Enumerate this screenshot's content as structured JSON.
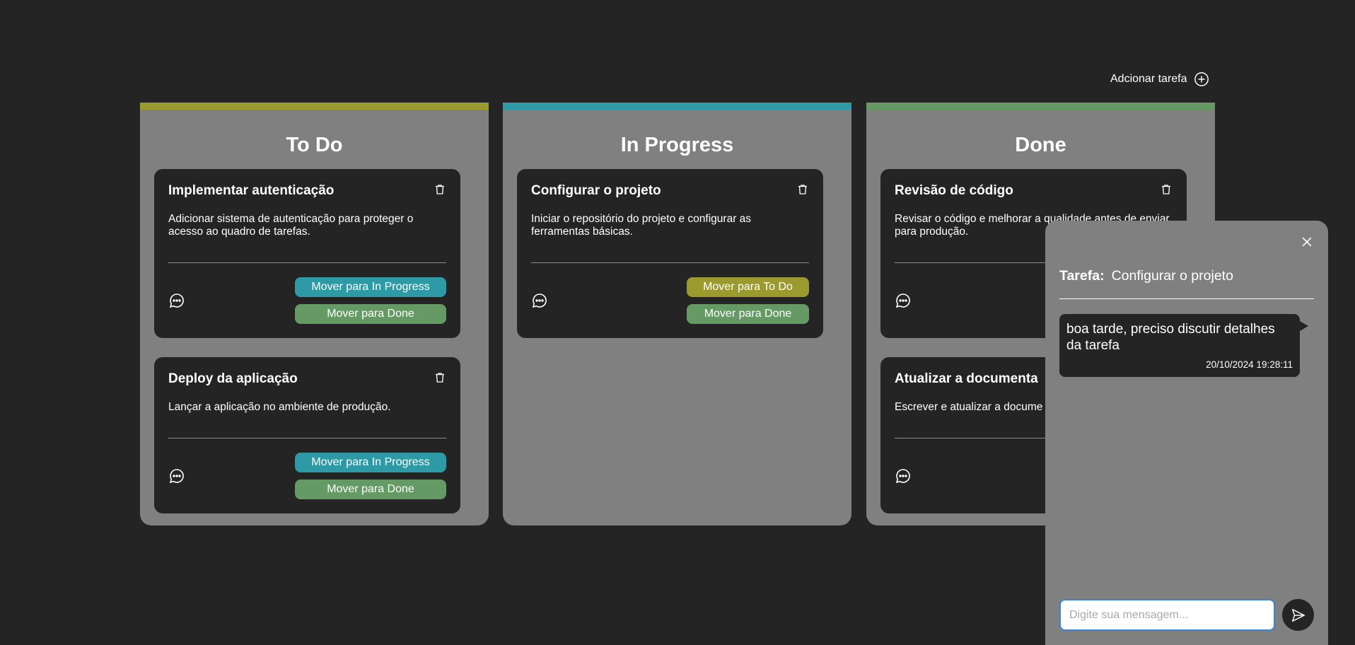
{
  "header": {
    "add_task_label": "Adcionar tarefa"
  },
  "colors": {
    "background": "#242424",
    "column": "#808080",
    "todo_accent": "#9a9a2e",
    "in_progress_accent": "#2d9aa5",
    "done_accent": "#659a65",
    "input_focus": "#3a86c8"
  },
  "columns": [
    {
      "title": "To Do",
      "cards": [
        {
          "title": "Implementar autenticação",
          "description": "Adicionar sistema de autenticação para proteger o acesso ao quadro de tarefas.",
          "buttons": [
            "Mover para In Progress",
            "Mover para Done"
          ]
        },
        {
          "title": "Deploy da aplicação",
          "description": "Lançar a aplicação no ambiente de produção.",
          "buttons": [
            "Mover para In Progress",
            "Mover para Done"
          ]
        }
      ]
    },
    {
      "title": "In Progress",
      "cards": [
        {
          "title": "Configurar o projeto",
          "description": "Iniciar o repositório do projeto e configurar as ferramentas básicas.",
          "buttons": [
            "Mover para To Do",
            "Mover para Done"
          ]
        }
      ]
    },
    {
      "title": "Done",
      "cards": [
        {
          "title": "Revisão de código",
          "description": "Revisar o código e melhorar a qualidade antes de enviar para produção.",
          "buttons": [
            "",
            ""
          ]
        },
        {
          "title": "Atualizar a documenta",
          "description": "Escrever e atualizar a docume",
          "buttons": [
            "",
            ""
          ]
        }
      ]
    }
  ],
  "chat": {
    "task_label": "Tarefa:",
    "task_name": "Configurar o projeto",
    "messages": [
      {
        "text": "boa tarde, preciso discutir detalhes da tarefa",
        "time": "20/10/2024 19:28:11"
      }
    ],
    "input_placeholder": "Digite sua mensagem..."
  },
  "icons": {
    "add": "plus-circle-icon",
    "delete": "trash-icon",
    "comment": "chat-bubble-icon",
    "close": "close-icon",
    "send": "send-icon"
  }
}
